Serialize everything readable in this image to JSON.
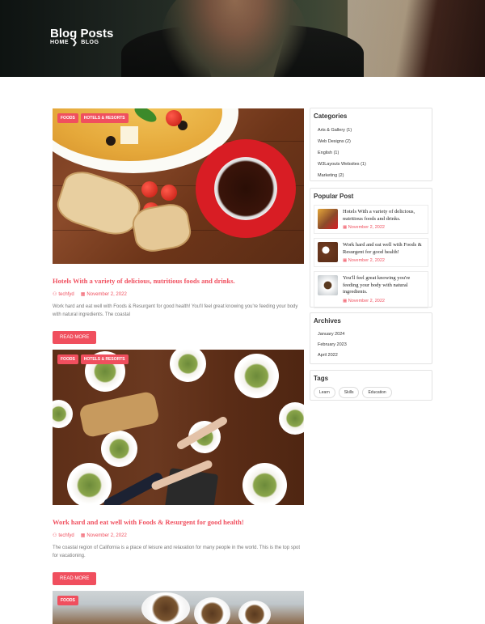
{
  "hero": {
    "title": "Blog Posts",
    "breadcrumb": {
      "home": "HOME",
      "separator": "❯",
      "current": "BLOG"
    }
  },
  "posts": [
    {
      "badges": [
        "FOODS",
        "HOTELS & RESORTS"
      ],
      "title": "Hotels With a variety of delicious, nutritious foods and drinks.",
      "author": "techfyd",
      "date": "November 2, 2022",
      "excerpt": "Work hard and eat well with Foods & Resurgent for good health! You'll feel great knowing you're feeding your body with natural ingredients. The coastal",
      "button": "READ MORE"
    },
    {
      "badges": [
        "FOODS",
        "HOTELS & RESORTS"
      ],
      "title": "Work hard and eat well with Foods & Resurgent for good health!",
      "author": "techfyd",
      "date": "November 2, 2022",
      "excerpt": "The coastal region of California is a place of leisure and relaxation for many people in the world. This is the top spot for vacationing.",
      "button": "READ MORE"
    },
    {
      "badges": [
        "FOODS"
      ]
    }
  ],
  "sidebar": {
    "categories": {
      "title": "Categories",
      "items": [
        "Arts & Gallery (1)",
        "Web Designs (2)",
        "English (1)",
        "W3Layouts Websites (1)",
        "Marketing (2)"
      ]
    },
    "popular": {
      "title": "Popular Post",
      "items": [
        {
          "title": "Hotels With a variety of delicious, nutritious foods and drinks.",
          "date": "November 2, 2022"
        },
        {
          "title": "Work hard and eat well with Foods & Resurgent for good health!",
          "date": "November 2, 2022"
        },
        {
          "title": "You'll feel great knowing you're feeding your body with natural ingredients.",
          "date": "November 2, 2022"
        }
      ]
    },
    "archives": {
      "title": "Archives",
      "items": [
        "January 2024",
        "February 2023",
        "April 2022"
      ]
    },
    "tags": {
      "title": "Tags",
      "items": [
        "Learn",
        "Skills",
        "Education"
      ]
    }
  },
  "icons": {
    "user": "user-icon",
    "calendar": "calendar-icon"
  },
  "colors": {
    "accent": "#f04f5e"
  }
}
